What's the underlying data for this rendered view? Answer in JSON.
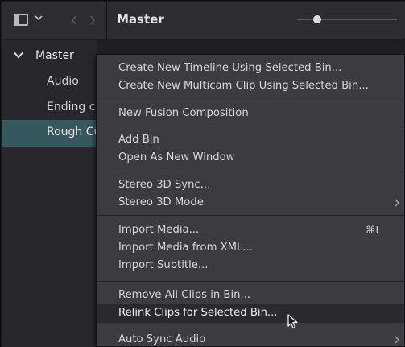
{
  "header": {
    "title": "Master",
    "icons": [
      "sidebar-toggle-icon",
      "chevron-down-icon",
      "back-arrow-icon",
      "forward-arrow-icon"
    ],
    "zoom_slider_level": 0.2
  },
  "sidebar": {
    "master_label": "Master",
    "items": [
      {
        "label": "Audio"
      },
      {
        "label": "Ending cr"
      },
      {
        "label": "Rough Cu"
      }
    ],
    "selected_index": 2
  },
  "context_menu": {
    "items": [
      {
        "label": "Create New Timeline Using Selected Bin..."
      },
      {
        "label": "Create New Multicam Clip Using Selected Bin..."
      },
      {
        "label": "New Fusion Composition"
      },
      {
        "label": "Add Bin"
      },
      {
        "label": "Open As New Window"
      },
      {
        "label": "Stereo 3D Sync..."
      },
      {
        "label": "Stereo 3D Mode",
        "submenu": true
      },
      {
        "label": "Import Media...",
        "shortcut": "⌘I"
      },
      {
        "label": "Import Media from XML..."
      },
      {
        "label": "Import Subtitle..."
      },
      {
        "label": "Remove All Clips in Bin..."
      },
      {
        "label": "Relink Clips for Selected Bin...",
        "hovered": true
      },
      {
        "label": "Auto Sync Audio",
        "submenu": true
      }
    ]
  },
  "colors": {
    "selection": "#35585f",
    "menu_bg": "#3c3c40",
    "hover_bg": "#2a2a2e"
  }
}
